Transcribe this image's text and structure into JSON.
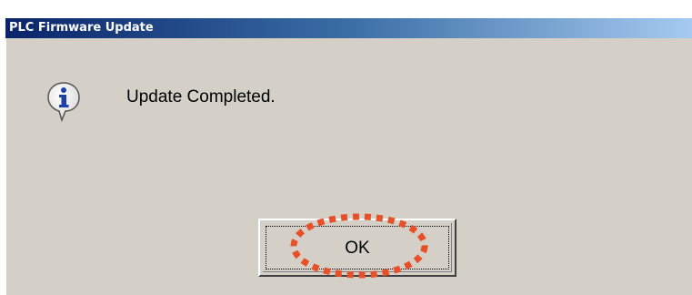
{
  "dialog": {
    "title": "PLC Firmware Update",
    "message": "Update Completed.",
    "icon": "info-icon",
    "ok_label": "OK"
  },
  "annotation": {
    "highlight_color": "#e8502a",
    "shape": "dotted-ellipse"
  },
  "colors": {
    "dialog_bg": "#d4d0c8",
    "titlebar_start": "#0a246a",
    "titlebar_end": "#a6caf0"
  }
}
